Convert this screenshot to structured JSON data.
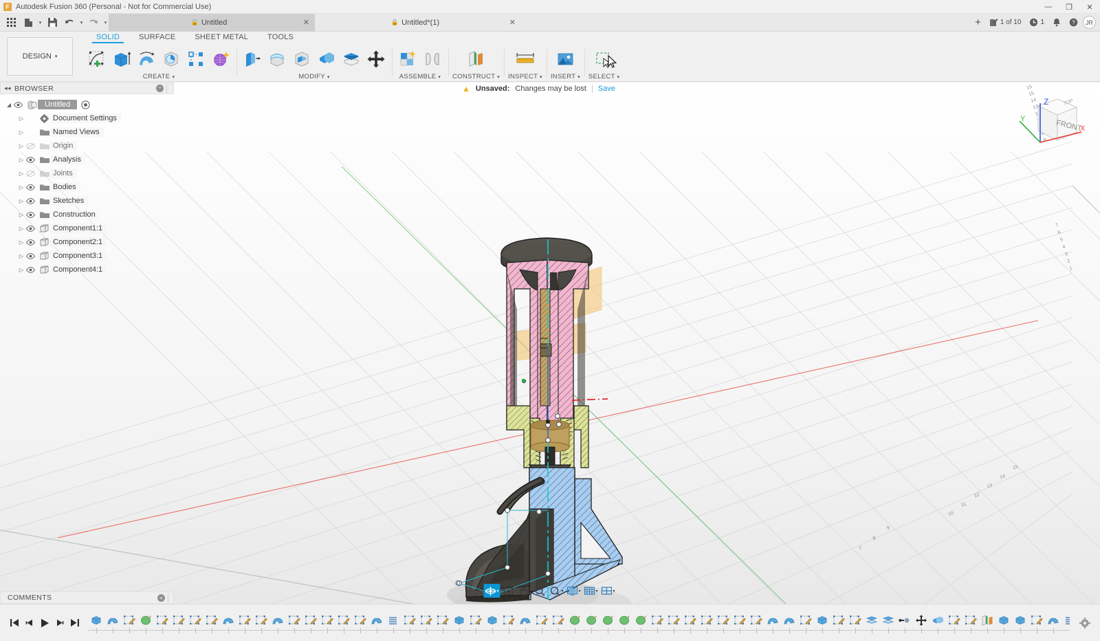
{
  "titlebar": {
    "app_title": "Autodesk Fusion 360 (Personal - Not for Commercial Use)",
    "logo_letter": "F",
    "minimize": "—",
    "maximize": "❐",
    "close": "✕"
  },
  "quickaccess": {
    "grid_icon": "app-grid-icon",
    "new_icon": "new-document-icon",
    "save_icon": "save-icon",
    "undo_icon": "undo-icon",
    "redo_icon": "redo-icon",
    "tabs": [
      {
        "label": "Untitled",
        "active": false,
        "locked": true,
        "close": "✕"
      },
      {
        "label": "Untitled*(1)",
        "active": true,
        "locked": true,
        "close": "✕"
      }
    ],
    "new_tab": "+",
    "jobs_label": "1 of 10",
    "recent_label": "1",
    "notifications_icon": "bell-icon",
    "help_icon": "help-icon",
    "avatar_initials": "JR"
  },
  "ribbon": {
    "workspace": "DESIGN",
    "workspace_caret": "▾",
    "tabs": [
      {
        "label": "SOLID",
        "active": true
      },
      {
        "label": "SURFACE",
        "active": false
      },
      {
        "label": "SHEET METAL",
        "active": false
      },
      {
        "label": "TOOLS",
        "active": false
      }
    ],
    "panels": [
      {
        "label": "CREATE",
        "caret": "▾",
        "tools": [
          "create-sketch-icon",
          "extrude-icon",
          "revolve-icon",
          "sweep-icon",
          "pattern-icon",
          "form-icon"
        ]
      },
      {
        "label": "MODIFY",
        "caret": "▾",
        "tools": [
          "press-pull-icon",
          "fillet-icon",
          "shell-icon",
          "combine-icon",
          "offset-face-icon",
          "move-copy-icon"
        ]
      },
      {
        "label": "ASSEMBLE",
        "caret": "▾",
        "tools": [
          "new-component-icon",
          "joint-icon"
        ]
      },
      {
        "label": "CONSTRUCT",
        "caret": "▾",
        "tools": [
          "offset-plane-icon"
        ]
      },
      {
        "label": "INSPECT",
        "caret": "▾",
        "tools": [
          "measure-icon"
        ]
      },
      {
        "label": "INSERT",
        "caret": "▾",
        "tools": [
          "insert-image-icon"
        ]
      },
      {
        "label": "SELECT",
        "caret": "▾",
        "tools": [
          "window-selection-icon"
        ]
      }
    ]
  },
  "browser": {
    "title": "BROWSER",
    "collapse_icon": "collapse-left-icon",
    "minus_icon": "−",
    "tree": [
      {
        "label": "Untitled",
        "depth": 0,
        "root": true,
        "arrow": "◢",
        "eye": true,
        "icon": "document-icon",
        "dim": false,
        "target": true
      },
      {
        "label": "Document Settings",
        "depth": 1,
        "arrow": "▷",
        "eye": false,
        "icon": "gear-icon",
        "dim": false
      },
      {
        "label": "Named Views",
        "depth": 1,
        "arrow": "▷",
        "eye": false,
        "icon": "folder-icon",
        "dim": false
      },
      {
        "label": "Origin",
        "depth": 1,
        "arrow": "▷",
        "eye": true,
        "icon": "folder-icon",
        "dim": true
      },
      {
        "label": "Analysis",
        "depth": 1,
        "arrow": "▷",
        "eye": true,
        "icon": "folder-icon",
        "dim": false
      },
      {
        "label": "Joints",
        "depth": 1,
        "arrow": "▷",
        "eye": true,
        "icon": "folder-icon",
        "dim": true
      },
      {
        "label": "Bodies",
        "depth": 1,
        "arrow": "▷",
        "eye": true,
        "icon": "folder-icon",
        "dim": false
      },
      {
        "label": "Sketches",
        "depth": 1,
        "arrow": "▷",
        "eye": true,
        "icon": "folder-icon",
        "dim": false
      },
      {
        "label": "Construction",
        "depth": 1,
        "arrow": "▷",
        "eye": true,
        "icon": "folder-icon",
        "dim": false
      },
      {
        "label": "Component1:1",
        "depth": 1,
        "arrow": "▷",
        "eye": true,
        "icon": "component-icon",
        "dim": false
      },
      {
        "label": "Component2:1",
        "depth": 1,
        "arrow": "▷",
        "eye": true,
        "icon": "component-icon",
        "dim": false
      },
      {
        "label": "Component3:1",
        "depth": 1,
        "arrow": "▷",
        "eye": true,
        "icon": "component-icon",
        "dim": false
      },
      {
        "label": "Component4:1",
        "depth": 1,
        "arrow": "▷",
        "eye": true,
        "icon": "component-icon",
        "dim": false
      }
    ]
  },
  "unsaved": {
    "warning_icon": "warning-icon",
    "status": "Unsaved:",
    "message": "Changes may be lost",
    "save_link": "Save"
  },
  "viewcube": {
    "face_front": "FRONT",
    "face_top": "TOP",
    "axis_x": "X",
    "axis_y": "Y",
    "axis_z": "Z",
    "color_x": "#e8453c",
    "color_y": "#3ab54a",
    "color_z": "#3b5bdb"
  },
  "navbar": {
    "items": [
      {
        "name": "orbit-tool",
        "selected": true,
        "caret": true
      },
      {
        "name": "look-at-tool",
        "selected": false,
        "caret": false
      },
      {
        "name": "pan-tool",
        "selected": false,
        "caret": false
      },
      {
        "name": "zoom-tool",
        "selected": false,
        "caret": false
      },
      {
        "name": "zoom-window-tool",
        "selected": false,
        "caret": true
      },
      {
        "name": "display-settings",
        "selected": false,
        "caret": true
      },
      {
        "name": "grid-snaps",
        "selected": false,
        "caret": true
      },
      {
        "name": "viewports",
        "selected": false,
        "caret": true
      }
    ]
  },
  "comments": {
    "title": "COMMENTS",
    "plus_icon": "+"
  },
  "timeline": {
    "playback": [
      "skip-start-icon",
      "step-back-icon",
      "play-icon",
      "step-forward-icon",
      "skip-end-icon"
    ],
    "settings_icon": "gear-icon",
    "features": [
      "extrude-feature",
      "revolve-feature",
      "sketch-feature",
      "form-feature",
      "sketch-feature",
      "sketch-feature",
      "sketch-feature",
      "sketch-feature",
      "revolve-feature",
      "sketch-feature",
      "sketch-feature",
      "revolve-feature",
      "sketch-feature",
      "sketch-feature",
      "sketch-feature",
      "sketch-feature",
      "sketch-feature",
      "revolve-feature",
      "thread-feature",
      "sketch-feature",
      "sketch-feature",
      "sketch-feature",
      "extrude-feature",
      "sketch-feature",
      "extrude-feature",
      "sketch-feature",
      "revolve-feature",
      "sketch-feature",
      "sketch-feature",
      "form-feature",
      "form-feature",
      "form-feature",
      "form-feature",
      "form-feature",
      "sketch-feature",
      "sketch-feature",
      "sketch-feature",
      "sketch-feature",
      "sketch-feature",
      "sketch-feature",
      "sketch-feature",
      "revolve-feature",
      "revolve-feature",
      "sketch-feature",
      "extrude-feature",
      "sketch-feature",
      "sketch-feature",
      "offset-feature",
      "offset-feature",
      "joint-feature",
      "move-feature",
      "combine-feature",
      "sketch-feature",
      "sketch-feature",
      "plane-feature",
      "extrude-feature",
      "extrude-feature",
      "sketch-feature",
      "revolve-feature",
      "thread-feature",
      "fillet-feature",
      "mirror-feature",
      "sketch-feature",
      "extrude-feature",
      "revolve-feature",
      "pattern-feature",
      "sketch-feature",
      "pattern-feature",
      "pattern-feature",
      "sketch-feature",
      "sketch-feature",
      "pattern-feature"
    ]
  },
  "model": {
    "description": "sectioned-assembly-3d-model",
    "section_colors": {
      "pink": "#f0a8c8",
      "tan": "#c8a060",
      "olive": "#d8e08a",
      "blue": "#9cc8f0",
      "gray": "#4a4845"
    },
    "plane_color": "#f5c269",
    "axis_x_color": "#e8453c",
    "axis_y_color": "#3ab54a"
  },
  "origin_marker": "O"
}
